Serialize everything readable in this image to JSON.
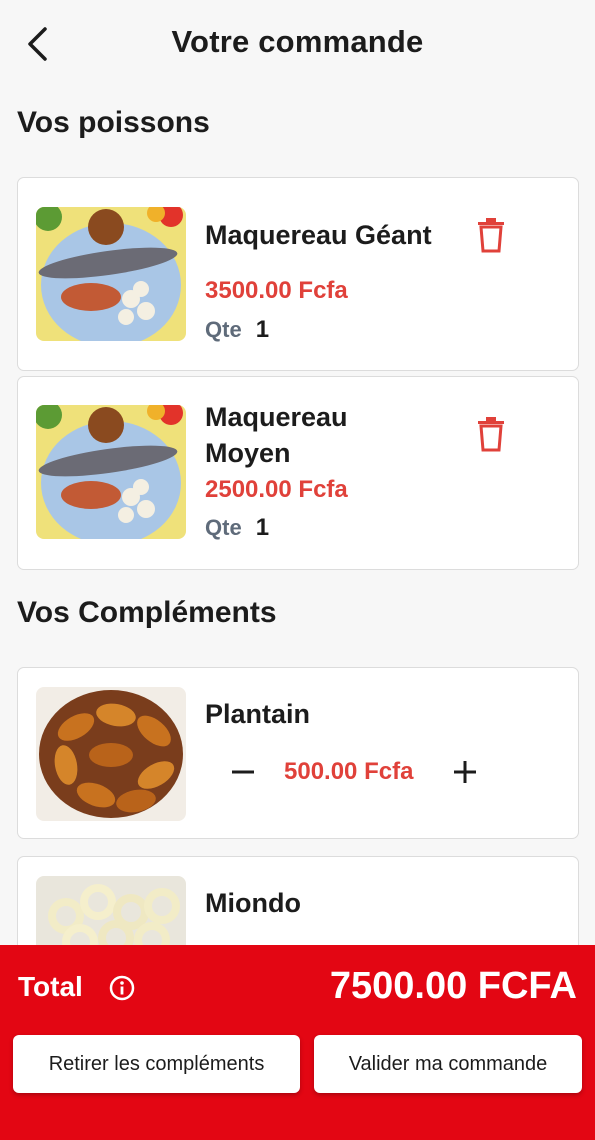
{
  "header": {
    "title": "Votre commande"
  },
  "fish_section": {
    "title": "Vos poissons",
    "items": [
      {
        "name": "Maquereau Géant",
        "price": "3500.00 Fcfa",
        "qty_label": "Qte",
        "qty": "1"
      },
      {
        "name_line1": "Maquereau",
        "name_line2": "Moyen",
        "price": "2500.00 Fcfa",
        "qty_label": "Qte",
        "qty": "1"
      }
    ]
  },
  "complements_section": {
    "title": "Vos Compléments",
    "items": [
      {
        "name": "Plantain",
        "price": "500.00 Fcfa"
      },
      {
        "name": "Miondo"
      }
    ]
  },
  "footer": {
    "total_label": "Total",
    "total_value": "7500.00 FCFA",
    "remove_button": "Retirer les compléments",
    "validate_button": "Valider ma commande"
  },
  "colors": {
    "accent_red": "#e30613",
    "price_red": "#e0413a",
    "background": "#f7f7f7"
  },
  "icons": [
    "back-arrow-icon",
    "trash-icon",
    "minus-icon",
    "plus-icon",
    "info-icon"
  ]
}
